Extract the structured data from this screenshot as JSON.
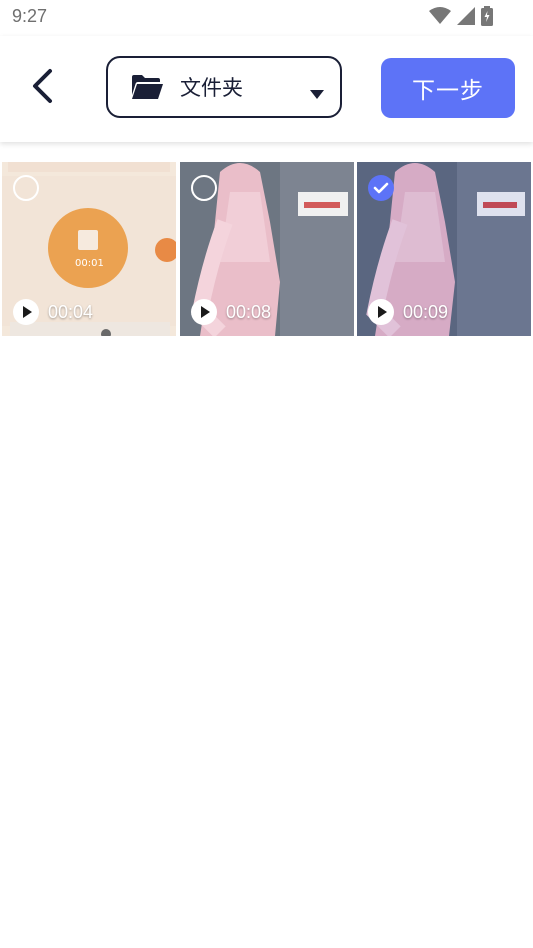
{
  "status_bar": {
    "time": "9:27",
    "icons": [
      "wifi-icon",
      "signal-icon",
      "battery-icon"
    ]
  },
  "header": {
    "back_icon": "chevron-left-icon",
    "folder_icon": "folder-open-icon",
    "folder_label": "文件夹",
    "dropdown_icon": "caret-down-icon",
    "next_label": "下一步"
  },
  "colors": {
    "accent": "#5d73f7",
    "dark": "#1a1f36"
  },
  "grid": {
    "items": [
      {
        "duration": "00:04",
        "selected": false,
        "thumb_time": "00:01"
      },
      {
        "duration": "00:08",
        "selected": false
      },
      {
        "duration": "00:09",
        "selected": true
      }
    ]
  }
}
